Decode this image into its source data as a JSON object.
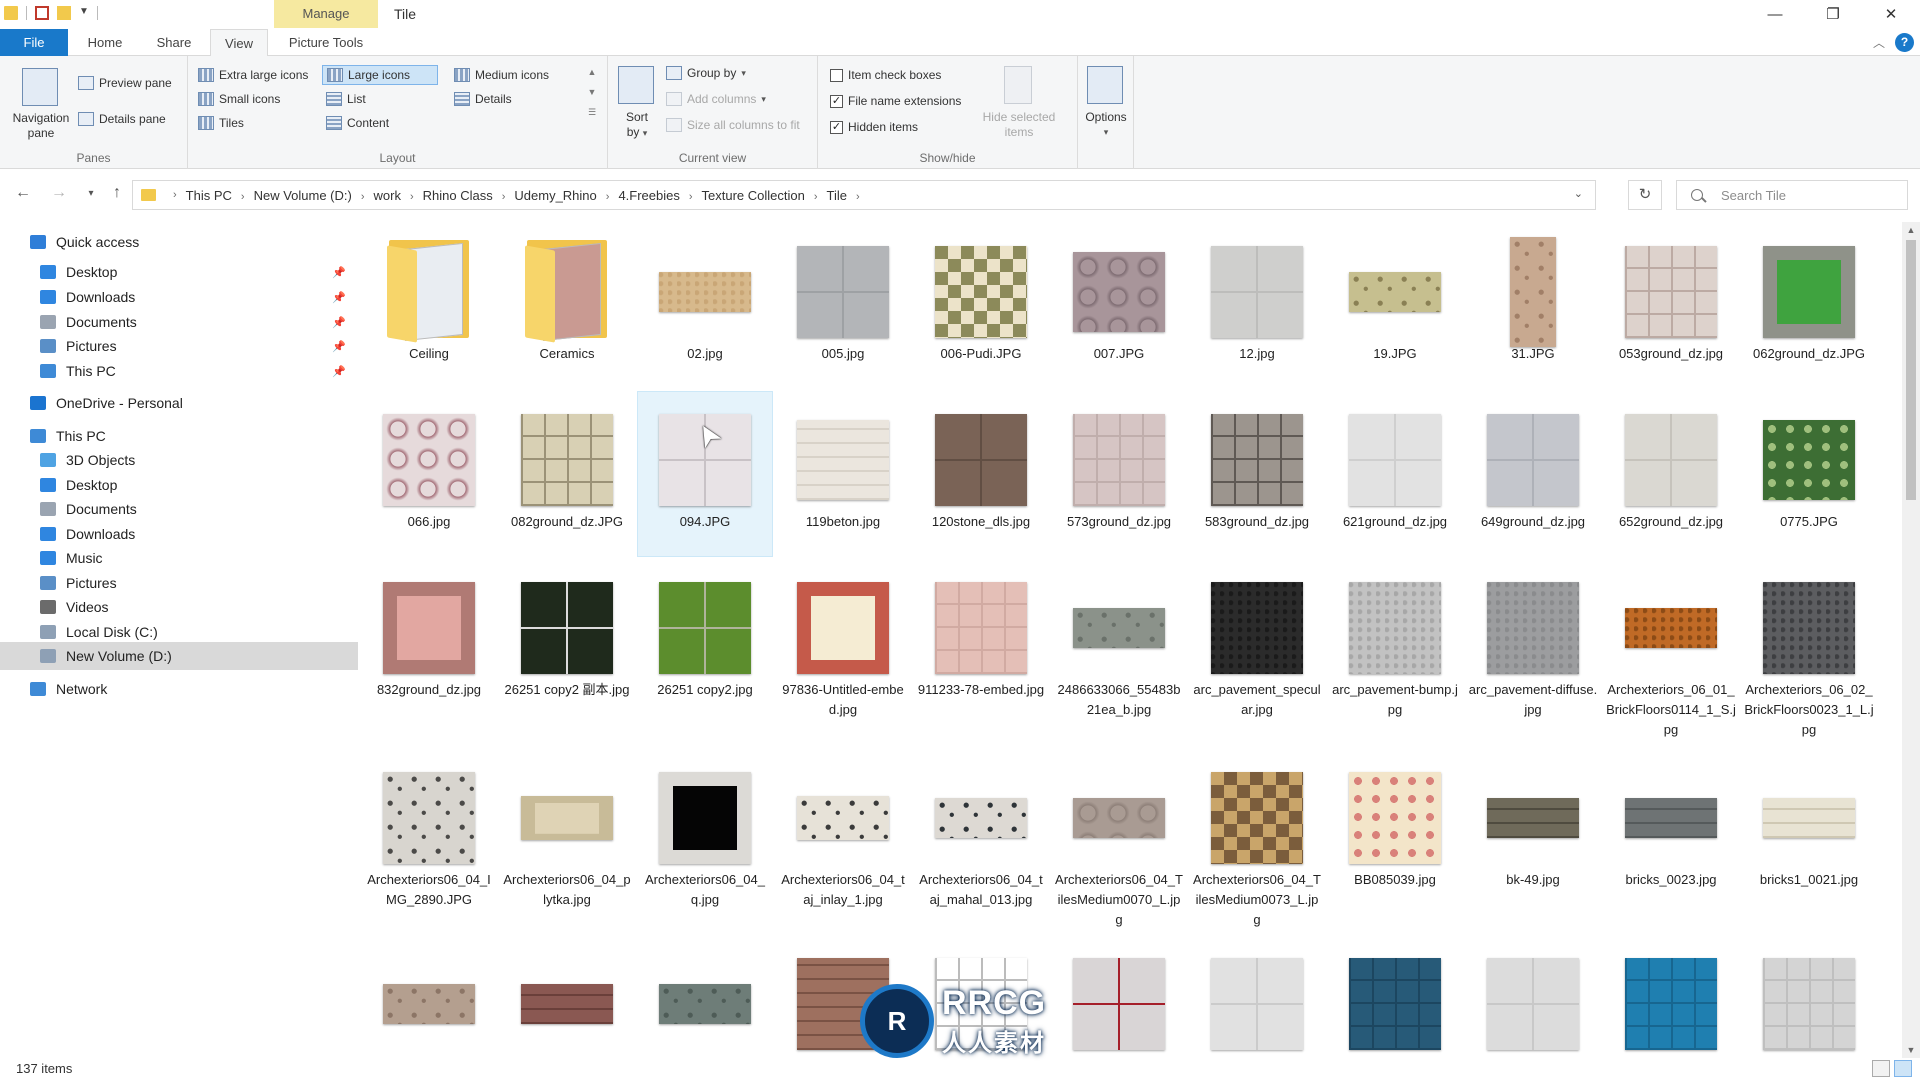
{
  "window": {
    "manage_label": "Manage",
    "title": "Tile",
    "minimize": "—",
    "restore": "❐",
    "close": "✕"
  },
  "tabs": [
    "File",
    "Home",
    "Share",
    "View",
    "Picture Tools"
  ],
  "ribbon": {
    "panes": {
      "navigation_pane": "Navigation pane",
      "preview_pane": "Preview pane",
      "details_pane": "Details pane",
      "group_label": "Panes"
    },
    "layout": {
      "extra_large": "Extra large icons",
      "large": "Large icons",
      "medium": "Medium icons",
      "small": "Small icons",
      "list": "List",
      "details": "Details",
      "tiles": "Tiles",
      "content": "Content",
      "group_label": "Layout"
    },
    "current_view": {
      "sort_by": "Sort by",
      "group_by": "Group by",
      "add_columns": "Add columns",
      "size_all": "Size all columns to fit",
      "group_label": "Current view"
    },
    "show_hide": {
      "item_check_boxes": "Item check boxes",
      "item_check_boxes_checked": false,
      "file_name_extensions": "File name extensions",
      "file_name_extensions_checked": true,
      "hidden_items": "Hidden items",
      "hidden_items_checked": true,
      "hide_selected": "Hide selected items",
      "group_label": "Show/hide"
    },
    "options": "Options"
  },
  "address": {
    "path": [
      "This PC",
      "New Volume (D:)",
      "work",
      "Rhino Class",
      "Udemy_Rhino",
      "4.Freebies",
      "Texture Collection",
      "Tile"
    ],
    "search_placeholder": "Search Tile"
  },
  "nav": {
    "items": [
      {
        "label": "Quick access",
        "icon": "star-icon",
        "color": "#2f7ed8",
        "indent": 0,
        "pinned": false
      },
      {
        "label": "Desktop",
        "icon": "desktop-icon",
        "color": "#2f86e0",
        "indent": 1,
        "pinned": true
      },
      {
        "label": "Downloads",
        "icon": "download-icon",
        "color": "#2f86e0",
        "indent": 1,
        "pinned": true
      },
      {
        "label": "Documents",
        "icon": "document-icon",
        "color": "#9aa4b1",
        "indent": 1,
        "pinned": true
      },
      {
        "label": "Pictures",
        "icon": "pictures-icon",
        "color": "#5a8fc7",
        "indent": 1,
        "pinned": true
      },
      {
        "label": "This PC",
        "icon": "computer-icon",
        "color": "#3e8ad6",
        "indent": 1,
        "pinned": true
      },
      {
        "label": "OneDrive - Personal",
        "icon": "cloud-icon",
        "color": "#1b74d0",
        "indent": 0,
        "pinned": false
      },
      {
        "label": "This PC",
        "icon": "computer-icon",
        "color": "#3e8ad6",
        "indent": 0,
        "pinned": false
      },
      {
        "label": "3D Objects",
        "icon": "cube-icon",
        "color": "#4fa3e3",
        "indent": 1,
        "pinned": false
      },
      {
        "label": "Desktop",
        "icon": "desktop-icon",
        "color": "#2f86e0",
        "indent": 1,
        "pinned": false
      },
      {
        "label": "Documents",
        "icon": "document-icon",
        "color": "#9aa4b1",
        "indent": 1,
        "pinned": false
      },
      {
        "label": "Downloads",
        "icon": "download-icon",
        "color": "#2f86e0",
        "indent": 1,
        "pinned": false
      },
      {
        "label": "Music",
        "icon": "music-icon",
        "color": "#2f86e0",
        "indent": 1,
        "pinned": false
      },
      {
        "label": "Pictures",
        "icon": "pictures-icon",
        "color": "#5a8fc7",
        "indent": 1,
        "pinned": false
      },
      {
        "label": "Videos",
        "icon": "video-icon",
        "color": "#6b6b6b",
        "indent": 1,
        "pinned": false
      },
      {
        "label": "Local Disk (C:)",
        "icon": "drive-icon",
        "color": "#8ea0b5",
        "indent": 1,
        "pinned": false
      },
      {
        "label": "New Volume (D:)",
        "icon": "drive-icon",
        "color": "#8ea0b5",
        "indent": 1,
        "pinned": false,
        "selected": true
      },
      {
        "label": "Network",
        "icon": "network-icon",
        "color": "#3e8ad6",
        "indent": 0,
        "pinned": false
      }
    ]
  },
  "files": [
    {
      "name": "Ceiling",
      "kind": "folder",
      "page": "#e9edf2",
      "size": "full"
    },
    {
      "name": "Ceramics",
      "kind": "folder",
      "page": "#c99a92",
      "size": "full"
    },
    {
      "name": "02.jpg",
      "kind": "image",
      "c1": "#d7b98c",
      "c2": "#c9a676",
      "pattern": "noise",
      "size": "wide"
    },
    {
      "name": "005.jpg",
      "kind": "image",
      "c1": "#b3b5b8",
      "c2": "#9ea1a4",
      "pattern": "grid2",
      "size": "full"
    },
    {
      "name": "006-Pudi.JPG",
      "kind": "image",
      "c1": "#ece3c9",
      "c2": "#8c8a5a",
      "pattern": "checker",
      "size": "full"
    },
    {
      "name": "007.JPG",
      "kind": "image",
      "c1": "#a8959a",
      "c2": "#7e6c72",
      "pattern": "hex",
      "size": "mid"
    },
    {
      "name": "12.jpg",
      "kind": "image",
      "c1": "#cfcfcd",
      "c2": "#bdbdbb",
      "pattern": "grid2",
      "size": "full"
    },
    {
      "name": "19.JPG",
      "kind": "image",
      "c1": "#c6bf8f",
      "c2": "#8a8054",
      "pattern": "ornate",
      "size": "wide"
    },
    {
      "name": "31.JPG",
      "kind": "image",
      "c1": "#c8a990",
      "c2": "#a17f67",
      "pattern": "ornate",
      "size": "tall"
    },
    {
      "name": "053ground_dz.jpg",
      "kind": "image",
      "c1": "#ddd2cc",
      "c2": "#bcaaa3",
      "pattern": "grid4",
      "size": "full"
    },
    {
      "name": "062ground_dz.JPG",
      "kind": "image",
      "c1": "#3fa33f",
      "c2": "#8f9289",
      "pattern": "frame",
      "size": "full"
    },
    {
      "name": "066.jpg",
      "kind": "image",
      "c1": "#e6dadb",
      "c2": "#a56f79",
      "pattern": "hex",
      "size": "full"
    },
    {
      "name": "082ground_dz.JPG",
      "kind": "image",
      "c1": "#d8d0b4",
      "c2": "#9b9277",
      "pattern": "grid4",
      "size": "full"
    },
    {
      "name": "094.JPG",
      "kind": "image",
      "c1": "#e8e3e6",
      "c2": "#c8c2c6",
      "pattern": "grid2",
      "size": "full",
      "selected": true
    },
    {
      "name": "119beton.jpg",
      "kind": "image",
      "c1": "#ebe6de",
      "c2": "#d8d2c8",
      "pattern": "brick",
      "size": "mid"
    },
    {
      "name": "120stone_dls.jpg",
      "kind": "image",
      "c1": "#7a6356",
      "c2": "#614e43",
      "pattern": "grid2",
      "size": "full"
    },
    {
      "name": "573ground_dz.jpg",
      "kind": "image",
      "c1": "#d6c5c4",
      "c2": "#c0aeac",
      "pattern": "grid4",
      "size": "full"
    },
    {
      "name": "583ground_dz.jpg",
      "kind": "image",
      "c1": "#9c958e",
      "c2": "#5f5954",
      "pattern": "grid4",
      "size": "full"
    },
    {
      "name": "621ground_dz.jpg",
      "kind": "image",
      "c1": "#e2e2e2",
      "c2": "#cfcfcf",
      "pattern": "grid2",
      "size": "full"
    },
    {
      "name": "649ground_dz.jpg",
      "kind": "image",
      "c1": "#c4c6cc",
      "c2": "#aeb1b8",
      "pattern": "grid2",
      "size": "full"
    },
    {
      "name": "652ground_dz.jpg",
      "kind": "image",
      "c1": "#dad8d2",
      "c2": "#c6c3bc",
      "pattern": "grid2",
      "size": "full"
    },
    {
      "name": "0775.JPG",
      "kind": "image",
      "c1": "#3d6e34",
      "c2": "#9fbf7d",
      "pattern": "dots",
      "size": "mid"
    },
    {
      "name": "832ground_dz.jpg",
      "kind": "image",
      "c1": "#e2a7a1",
      "c2": "#b07a74",
      "pattern": "frame",
      "size": "full"
    },
    {
      "name": "26251 copy2 副本.jpg",
      "kind": "image",
      "c1": "#1f2a1c",
      "c2": "#dcdcdc",
      "pattern": "grid2",
      "size": "full"
    },
    {
      "name": "26251 copy2.jpg",
      "kind": "image",
      "c1": "#5c8d2d",
      "c2": "#b0b49b",
      "pattern": "grid2",
      "size": "full"
    },
    {
      "name": "97836-Untitled-embed.jpg",
      "kind": "image",
      "c1": "#f5ecd3",
      "c2": "#c55a4a",
      "pattern": "frame",
      "size": "full"
    },
    {
      "name": "911233-78-embed.jpg",
      "kind": "image",
      "c1": "#e4bfb7",
      "c2": "#d1aaa2",
      "pattern": "grid4",
      "size": "full"
    },
    {
      "name": "2486633066_55483b21ea_b.jpg",
      "kind": "image",
      "c1": "#8b928a",
      "c2": "#6a716a",
      "pattern": "ornate",
      "size": "wide"
    },
    {
      "name": "arc_pavement_specular.jpg",
      "kind": "image",
      "c1": "#2b2b2b",
      "c2": "#1a1a1a",
      "pattern": "noise",
      "size": "full"
    },
    {
      "name": "arc_pavement-bump.jpg",
      "kind": "image",
      "c1": "#c2c2c2",
      "c2": "#a7a7a7",
      "pattern": "noise",
      "size": "full"
    },
    {
      "name": "arc_pavement-diffuse.jpg",
      "kind": "image",
      "c1": "#9c9d9f",
      "c2": "#8a8b8d",
      "pattern": "noise",
      "size": "full"
    },
    {
      "name": "Archexteriors_06_01_BrickFloors0114_1_S.jpg",
      "kind": "image",
      "c1": "#c06a26",
      "c2": "#8c4b16",
      "pattern": "noise",
      "size": "wide"
    },
    {
      "name": "Archexteriors_06_02_BrickFloors0023_1_L.jpg",
      "kind": "image",
      "c1": "#5c5d60",
      "c2": "#3d3e41",
      "pattern": "noise",
      "size": "full"
    },
    {
      "name": "Archexteriors06_04_IMG_2890.JPG",
      "kind": "image",
      "c1": "#d8d5cf",
      "c2": "#4b4a48",
      "pattern": "ornate",
      "size": "full"
    },
    {
      "name": "Archexteriors06_04_plytka.jpg",
      "kind": "image",
      "c1": "#dfd3b5",
      "c2": "#c8bb98",
      "pattern": "frame",
      "size": "short"
    },
    {
      "name": "Archexteriors06_04_q.jpg",
      "kind": "image",
      "c1": "#050505",
      "c2": "#dcdad6",
      "pattern": "frame",
      "size": "full"
    },
    {
      "name": "Archexteriors06_04_taj_inlay_1.jpg",
      "kind": "image",
      "c1": "#e7e2d8",
      "c2": "#3b3b3b",
      "pattern": "ornate",
      "size": "short"
    },
    {
      "name": "Archexteriors06_04_taj_mahal_013.jpg",
      "kind": "image",
      "c1": "#ddd9d3",
      "c2": "#2e3438",
      "pattern": "ornate",
      "size": "wide"
    },
    {
      "name": "Archexteriors06_04_TilesMedium0070_L.jpg",
      "kind": "image",
      "c1": "#a99b93",
      "c2": "#8d7f78",
      "pattern": "hex",
      "size": "wide"
    },
    {
      "name": "Archexteriors06_04_TilesMedium0073_L.jpg",
      "kind": "image",
      "c1": "#7b5d3c",
      "c2": "#c9a56a",
      "pattern": "checker",
      "size": "full"
    },
    {
      "name": "BB085039.jpg",
      "kind": "image",
      "c1": "#f3e5c9",
      "c2": "#d9817a",
      "pattern": "dots",
      "size": "full"
    },
    {
      "name": "bk-49.jpg",
      "kind": "image",
      "c1": "#6f6a5a",
      "c2": "#4f4b3f",
      "pattern": "brick",
      "size": "wide"
    },
    {
      "name": "bricks_0023.jpg",
      "kind": "image",
      "c1": "#6e7374",
      "c2": "#555a5b",
      "pattern": "brick",
      "size": "wide"
    },
    {
      "name": "bricks1_0021.jpg",
      "kind": "image",
      "c1": "#e8e3d3",
      "c2": "#cfc8b3",
      "pattern": "brick",
      "size": "wide"
    },
    {
      "name": "",
      "kind": "image",
      "c1": "#b49f8f",
      "c2": "#8c7566",
      "pattern": "ornate",
      "size": "wide"
    },
    {
      "name": "",
      "kind": "image",
      "c1": "#8a5852",
      "c2": "#6a3f3a",
      "pattern": "brick",
      "size": "wide"
    },
    {
      "name": "",
      "kind": "image",
      "c1": "#6e7d78",
      "c2": "#4e5c57",
      "pattern": "ornate",
      "size": "wide"
    },
    {
      "name": "",
      "kind": "image",
      "c1": "#9e705f",
      "c2": "#7a5244",
      "pattern": "brick",
      "size": "full"
    },
    {
      "name": "",
      "kind": "image",
      "c1": "#ffffff",
      "c2": "#bcbcbc",
      "pattern": "grid4",
      "size": "full"
    },
    {
      "name": "",
      "kind": "image",
      "c1": "#d9d5d6",
      "c2": "#a51f2a",
      "pattern": "grid2",
      "size": "full"
    },
    {
      "name": "",
      "kind": "image",
      "c1": "#e1e1e1",
      "c2": "#cbcbcb",
      "pattern": "grid2",
      "size": "full"
    },
    {
      "name": "",
      "kind": "image",
      "c1": "#275a78",
      "c2": "#1c4660",
      "pattern": "grid4",
      "size": "full"
    },
    {
      "name": "",
      "kind": "image",
      "c1": "#dcdcdc",
      "c2": "#c8c8c8",
      "pattern": "grid2",
      "size": "full"
    },
    {
      "name": "",
      "kind": "image",
      "c1": "#1f7fb0",
      "c2": "#176690",
      "pattern": "grid4",
      "size": "full"
    },
    {
      "name": "",
      "kind": "image",
      "c1": "#d4d4d4",
      "c2": "#bfbfbf",
      "pattern": "grid4",
      "size": "full"
    }
  ],
  "status": {
    "item_count": "137 items"
  },
  "watermark": {
    "en": "RRCG",
    "cn": "人人素材"
  }
}
